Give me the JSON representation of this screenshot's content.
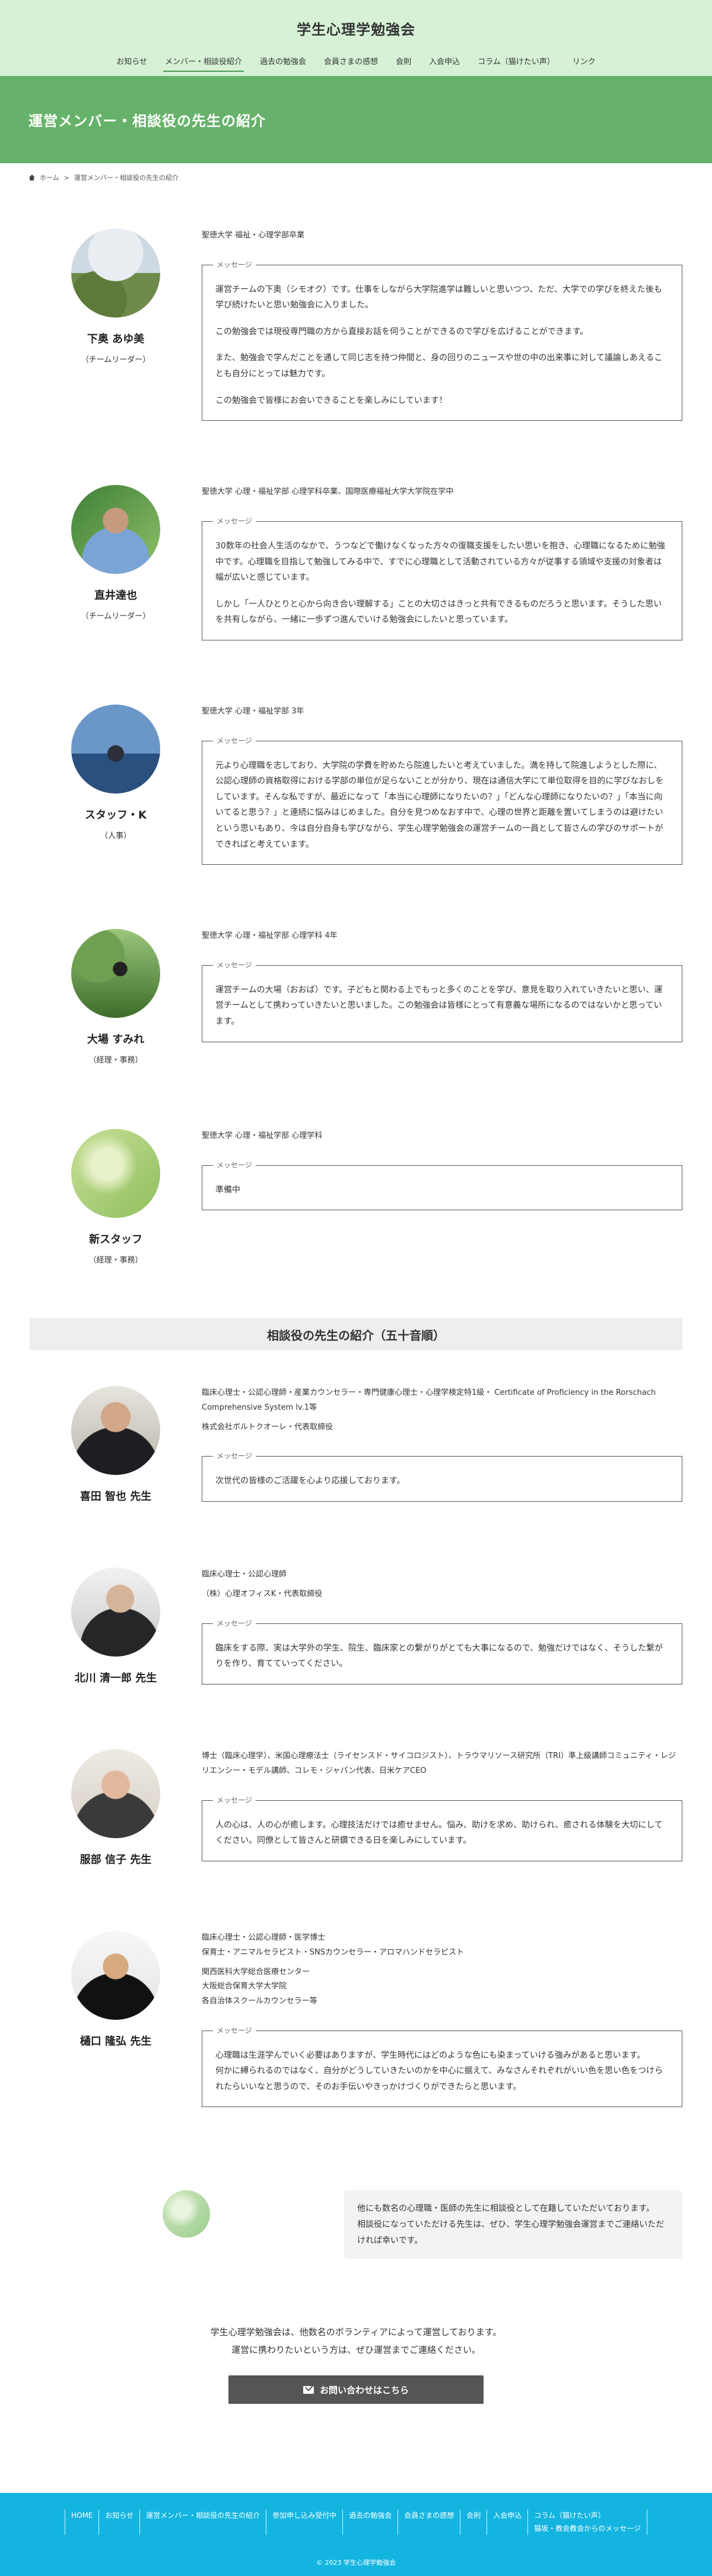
{
  "site": {
    "title": "学生心理学勉強会"
  },
  "nav": [
    {
      "label": "お知らせ"
    },
    {
      "label": "メンバー・相談役紹介"
    },
    {
      "label": "過去の勉強会"
    },
    {
      "label": "会員さまの感想"
    },
    {
      "label": "会則"
    },
    {
      "label": "入会申込"
    },
    {
      "label": "コラム（猫けたい声）"
    },
    {
      "label": "リンク"
    }
  ],
  "hero": {
    "title": "運営メンバー・相談役の先生の紹介"
  },
  "breadcrumb": {
    "home": "ホーム",
    "sep": ">",
    "current": "運営メンバー・相談役の先生の紹介"
  },
  "msg_label": "メッセージ",
  "members": [
    {
      "name": "下奥 あゆ美",
      "role": "（チームリーダー）",
      "affiliation": [
        "聖徳大学 福祉・心理学部卒業"
      ],
      "message": [
        "運営チームの下奥（シモオク）です。仕事をしながら大学院進学は難しいと思いつつ、ただ、大学での学びを終えた後も学び続けたいと思い勉強会に入りました。",
        "この勉強会では現役専門職の方から直接お話を伺うことができるので学びを広げることができます。",
        "また、勉強会で学んだことを通して同じ志を持つ仲間と、身の回りのニュースや世の中の出来事に対して議論しあえることも自分にとっては魅力です。",
        "この勉強会で皆様にお会いできることを楽しみにしています！"
      ]
    },
    {
      "name": "直井達也",
      "role": "（チームリーダー）",
      "affiliation": [
        "聖徳大学 心理・福祉学部 心理学科卒業、国際医療福祉大学大学院在学中"
      ],
      "message": [
        "30数年の社会人生活のなかで、うつなどで働けなくなった方々の復職支援をしたい思いを抱き、心理職になるために勉強中です。心理職を目指して勉強してみる中で、すでに心理職として活動されている方々が従事する領域や支援の対象者は幅が広いと感じています。",
        "しかし「一人ひとりと心から向き合い理解する」ことの大切さはきっと共有できるものだろうと思います。そうした思いを共有しながら、一緒に一歩ずつ進んでいける勉強会にしたいと思っています。"
      ]
    },
    {
      "name": "スタッフ・K",
      "role": "（人事）",
      "affiliation": [
        "聖徳大学 心理・福祉学部 3年"
      ],
      "message": [
        "元より心理職を志しており、大学院の学費を貯めたら院進したいと考えていました。満を持して院進しようとした際に、公認心理師の資格取得における学部の単位が足らないことが分かり、現在は通信大学にて単位取得を目的に学びなおしをしています。そんな私ですが、最近になって「本当に心理師になりたいの？」「どんな心理師になりたいの？」「本当に向いてると思う？」と連続に悩みはじめました。自分を見つめなおす中で、心理の世界と距離を置いてしまうのは避けたいという思いもあり、今は自分自身も学びながら、学生心理学勉強会の運営チームの一員として皆さんの学びのサポートができればと考えています。"
      ]
    },
    {
      "name": "大場 すみれ",
      "role": "（経理・事務）",
      "affiliation": [
        "聖徳大学 心理・福祉学部 心理学科 4年"
      ],
      "message": [
        "運営チームの大場（おおば）です。子どもと関わる上でもっと多くのことを学び、意見を取り入れていきたいと思い、運営チームとして携わっていきたいと思いました。この勉強会は皆様にとって有意義な場所になるのではないかと思っています。"
      ]
    },
    {
      "name": "新スタッフ",
      "role": "（経理・事務）",
      "affiliation": [
        "聖徳大学 心理・福祉学部 心理学科"
      ],
      "message": [
        "準備中"
      ]
    }
  ],
  "advisors_heading": "相談役の先生の紹介（五十音順）",
  "advisors": [
    {
      "name": "喜田 智也 先生",
      "affiliation": [
        "臨床心理士・公認心理師・産業カウンセラー・専門健康心理士・心理学検定特1級・ Certificate of Proficiency in the Rorschach Comprehensive System lv.1等",
        "株式会社ボルトクオーレ・代表取締役"
      ],
      "message": [
        "次世代の皆様のご活躍を心より応援しております。"
      ]
    },
    {
      "name": "北川 清一郎 先生",
      "affiliation": [
        "臨床心理士・公認心理師",
        "（株）心理オフィスK・代表取締役"
      ],
      "message": [
        "臨床をする際、実は大学外の学生、院生、臨床家との繋がりがとても大事になるので、勉強だけではなく、そうした繋がりを作り、育てていってください。"
      ]
    },
    {
      "name": "服部 信子 先生",
      "affiliation": [
        "博士（臨床心理学）、米国心理療法士（ライセンスド・サイコロジスト）、トラウマリソース研究所（TRI）準上級講師コミュニティ・レジリエンシー・モデル講師、コレモ・ジャパン代表、日米ケアCEO"
      ],
      "message": [
        "人の心は、人の心が癒します。心理技法だけでは癒せません。悩み、助けを求め、助けられ、癒される体験を大切にしてください。同僚として皆さんと研鑽できる日を楽しみにしています。"
      ]
    },
    {
      "name": "樋口 隆弘 先生",
      "affiliation": [
        "臨床心理士・公認心理師・医学博士\n保育士・アニマルセラピスト・SNSカウンセラー・アロマハンドセラピスト",
        "関西医科大学総合医療センター\n大阪総合保育大学大学院\n各自治体スクールカウンセラー等"
      ],
      "message": [
        "心理職は生涯学んでいく必要はありますが、学生時代にはどのような色にも染まっていける強みがあると思います。\n何かに縛られるのではなく、自分がどうしていきたいのかを中心に据えて、みなさんそれぞれがいい色を思い色をつけられたらいいなと思うので、そのお手伝いやきっかけづくりができたらと思います。"
      ]
    }
  ],
  "note": {
    "text": "他にも数名の心理職・医師の先生に相談役として在籍していただいております。\n相談役になっていただける先生は、ぜひ、学生心理学勉強会運営までご連絡いただければ幸いです。"
  },
  "closing": {
    "line1": "学生心理学勉強会は、他数名のボランティアによって運営しております。",
    "line2": "運営に携わりたいという方は、ぜひ運営までご連絡ください。"
  },
  "cta": {
    "label": "お問い合わせはこちら",
    "icon": "mail-icon"
  },
  "footer": {
    "links": [
      {
        "label": "HOME"
      },
      {
        "label": "お知らせ"
      },
      {
        "label": "運営メンバー・相談役の先生の紹介"
      },
      {
        "label": "参加申し込み受付中"
      },
      {
        "label": "過去の勉強会"
      },
      {
        "label": "会員さまの感想"
      },
      {
        "label": "会則"
      },
      {
        "label": "入会申込"
      },
      {
        "label": "コラム（猫けたい声）\n猫坂・教会教会からのメッセージ"
      }
    ],
    "copyright": "© 2023 学生心理学勉強会"
  },
  "colors": {
    "header_bg": "#d6f1d6",
    "hero_bg": "#67b26a",
    "footer_bg": "#13b5e0",
    "cta_bg": "#555555"
  }
}
